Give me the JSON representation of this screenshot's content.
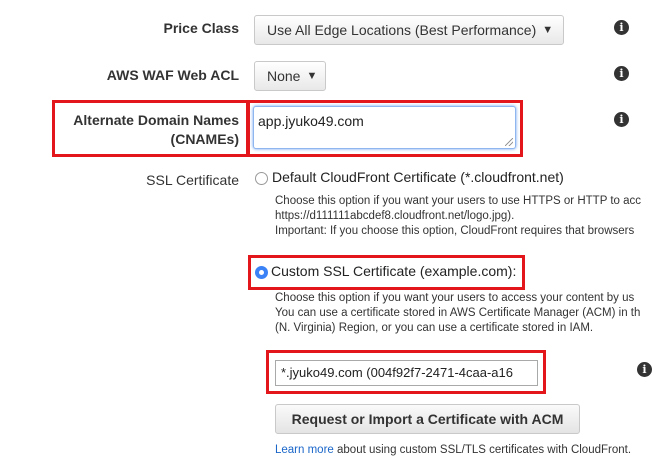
{
  "price_class": {
    "label": "Price Class",
    "value": "Use All Edge Locations (Best Performance)"
  },
  "waf": {
    "label": "AWS WAF Web ACL",
    "value": "None"
  },
  "cnames": {
    "label_line1": "Alternate Domain Names",
    "label_line2": "(CNAMEs)",
    "value": "app.jyuko49.com"
  },
  "ssl": {
    "label": "SSL Certificate",
    "default_option": {
      "label": "Default CloudFront Certificate (*.cloudfront.net)",
      "selected": false,
      "desc_lines": [
        "Choose this option if you want your users to use HTTPS or HTTP to acc",
        "https://d111111abcdef8.cloudfront.net/logo.jpg).",
        "Important: If you choose this option, CloudFront requires that browsers"
      ]
    },
    "custom_option": {
      "label": "Custom SSL Certificate (example.com):",
      "selected": true,
      "desc_lines": [
        "Choose this option if you want your users to access your content by us",
        "You can use a certificate stored in AWS Certificate Manager (ACM) in th",
        "(N. Virginia) Region, or you can use a certificate stored in IAM."
      ]
    },
    "certificate_value": "*.jyuko49.com (004f92f7-2471-4caa-a16",
    "acm_button": "Request or Import a Certificate with ACM",
    "learn_more_link": "Learn more",
    "learn_more_text": " about using custom SSL/TLS certificates with CloudFront."
  },
  "icons": {
    "info": "i",
    "caret": "⌄"
  },
  "colors": {
    "highlight": "#e3161c",
    "radio_selected": "#3b82f6",
    "link": "#1a66c9"
  }
}
